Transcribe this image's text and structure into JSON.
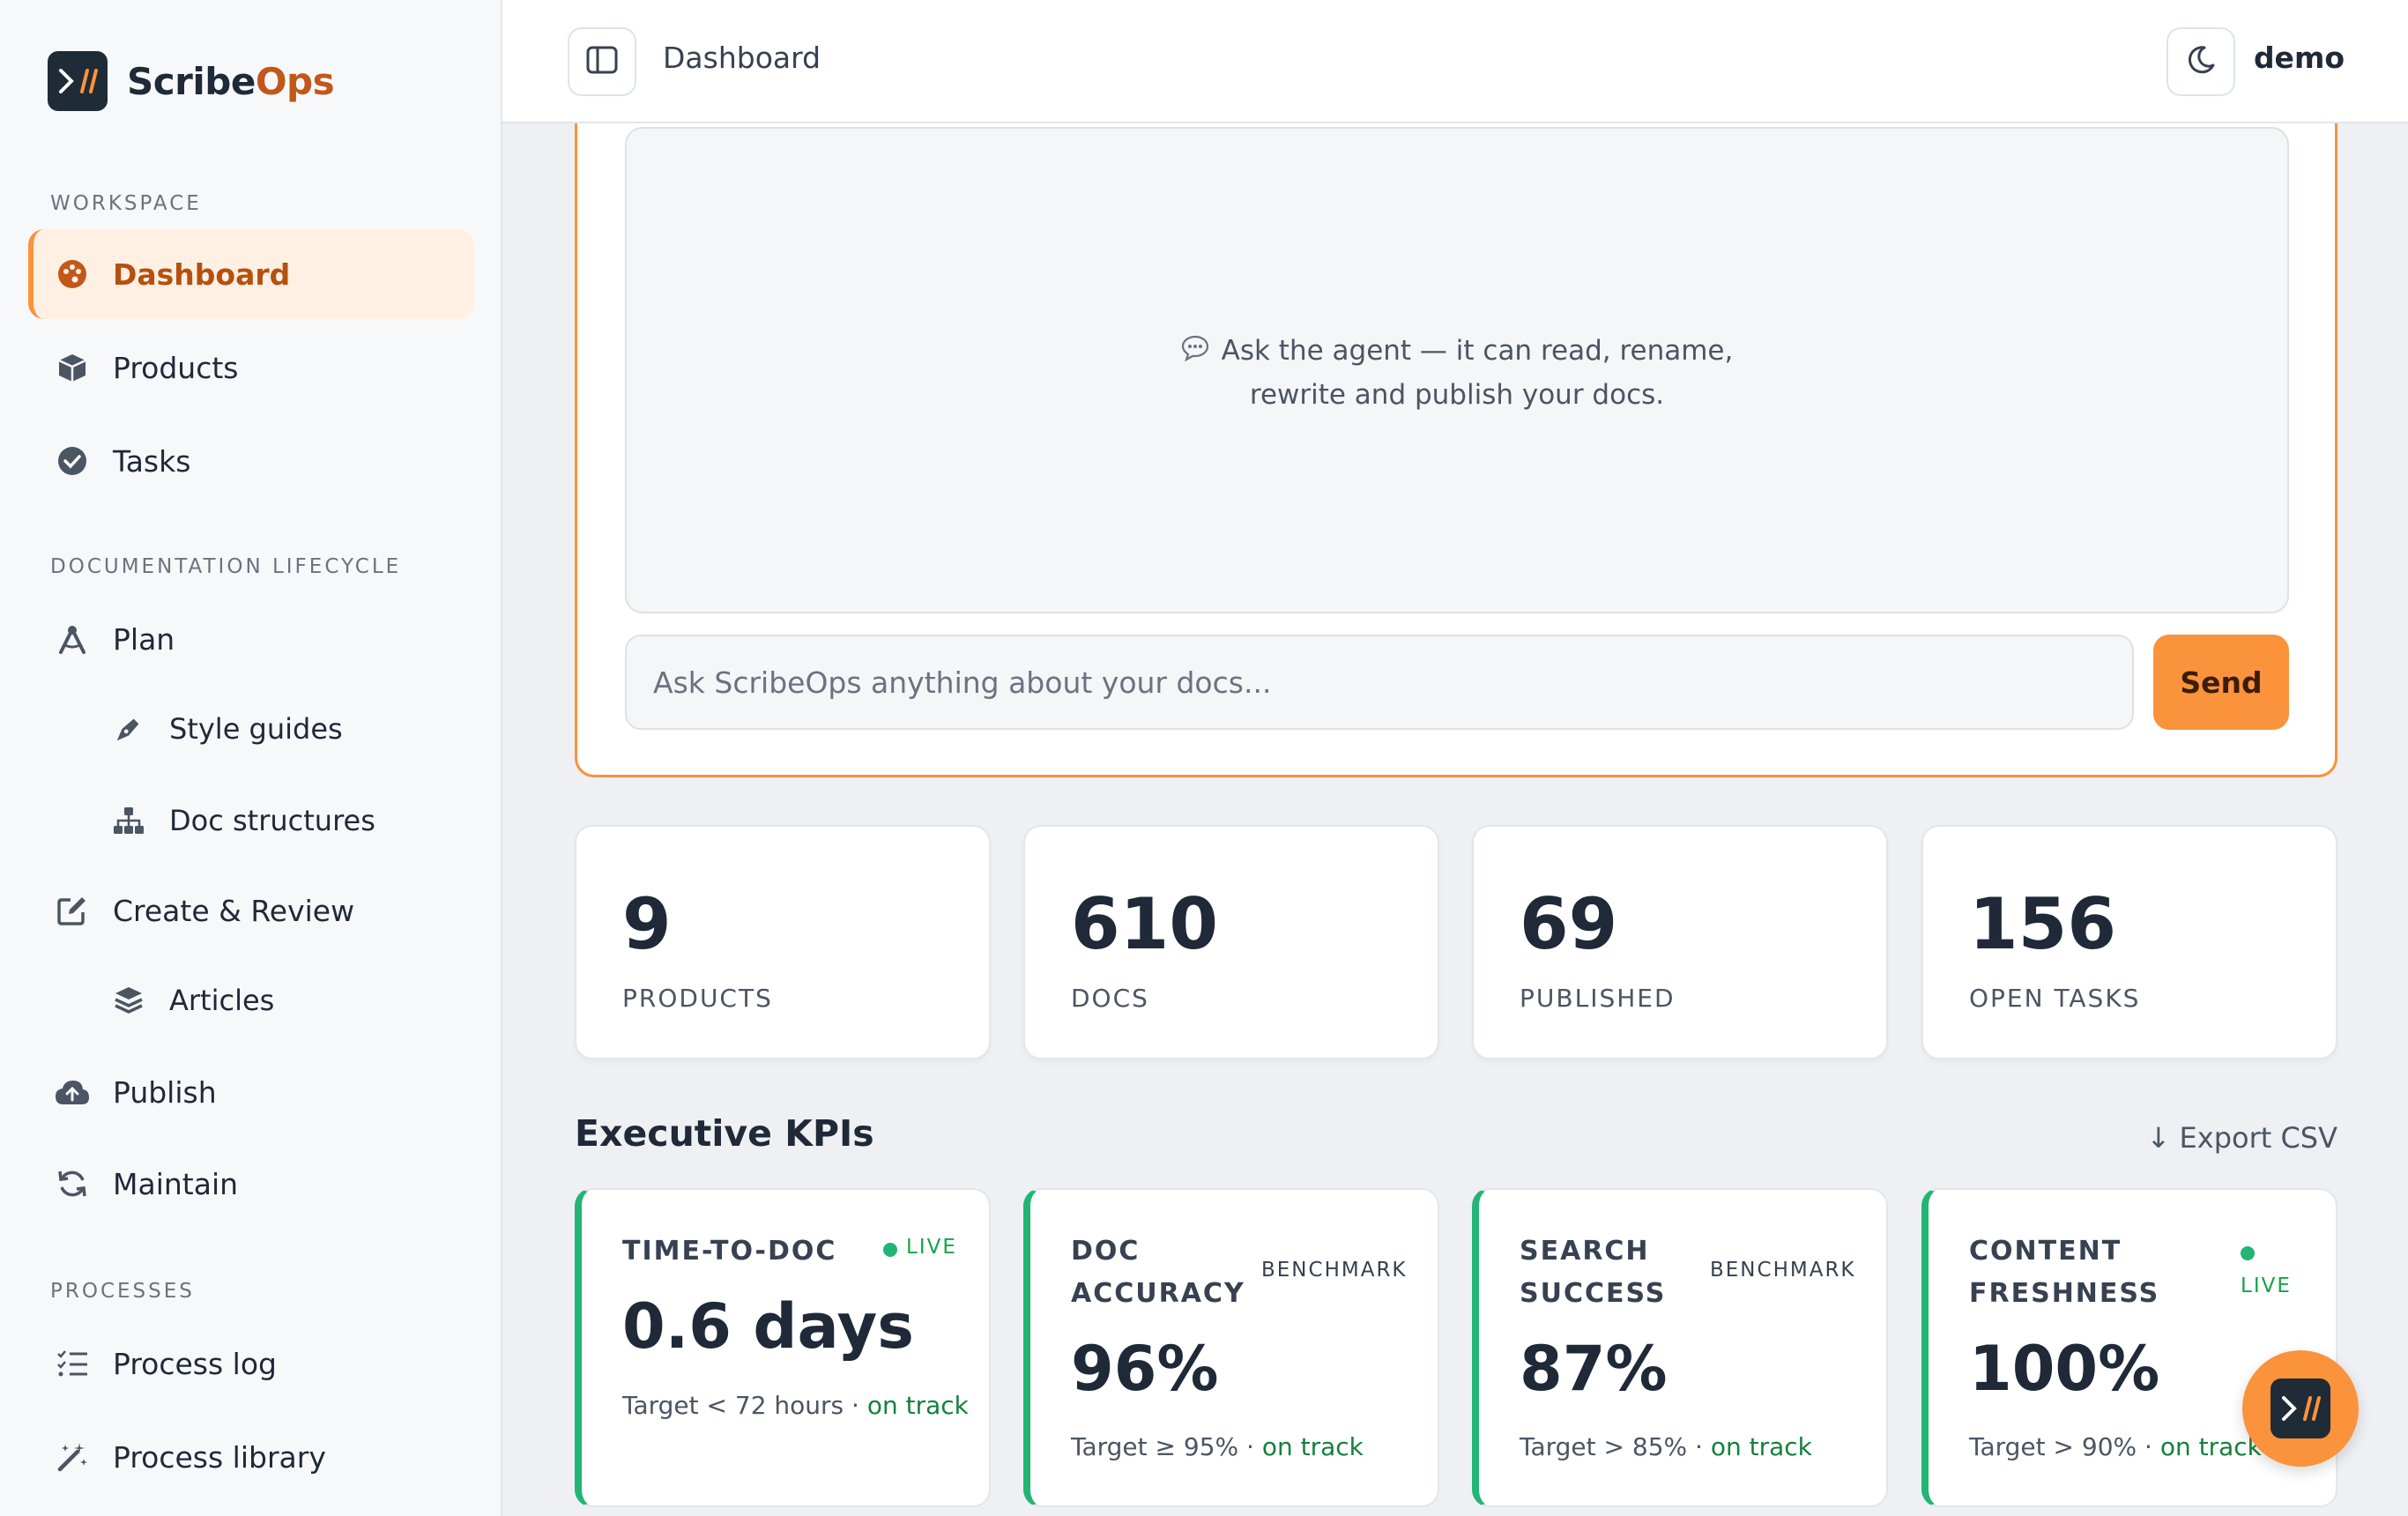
{
  "brand": {
    "name_part1": "Scribe",
    "name_part2": "Ops",
    "logo_glyph": ">//"
  },
  "sidebar": {
    "sections": [
      {
        "label": "WORKSPACE"
      },
      {
        "label": "DOCUMENTATION LIFECYCLE"
      },
      {
        "label": "PROCESSES"
      }
    ],
    "items": [
      {
        "label": "Dashboard",
        "icon": "palette-icon",
        "active": true
      },
      {
        "label": "Products",
        "icon": "box-icon"
      },
      {
        "label": "Tasks",
        "icon": "check-circle-icon"
      },
      {
        "label": "Plan",
        "icon": "compass-icon"
      },
      {
        "label": "Style guides",
        "icon": "pen-nib-icon"
      },
      {
        "label": "Doc structures",
        "icon": "sitemap-icon"
      },
      {
        "label": "Create & Review",
        "icon": "edit-icon"
      },
      {
        "label": "Articles",
        "icon": "layers-icon"
      },
      {
        "label": "Publish",
        "icon": "cloud-upload-icon"
      },
      {
        "label": "Maintain",
        "icon": "sync-icon"
      },
      {
        "label": "Process log",
        "icon": "list-check-icon"
      },
      {
        "label": "Process library",
        "icon": "magic-wand-icon"
      }
    ]
  },
  "topbar": {
    "breadcrumb": "Dashboard",
    "user": "demo"
  },
  "chat": {
    "hint_line1": "Ask the agent — it can read, rename,",
    "hint_line2": "rewrite and publish your docs.",
    "input_placeholder": "Ask ScribeOps anything about your docs...",
    "send_label": "Send"
  },
  "stats": [
    {
      "value": "9",
      "label": "PRODUCTS"
    },
    {
      "value": "610",
      "label": "DOCS"
    },
    {
      "value": "69",
      "label": "PUBLISHED"
    },
    {
      "value": "156",
      "label": "OPEN TASKS"
    }
  ],
  "kpis": {
    "title": "Executive KPIs",
    "export_label": "↓ Export CSV",
    "cards": [
      {
        "name_line1": "TIME-TO-DOC",
        "name_line2": "",
        "tag": "LIVE",
        "value": "0.6 days",
        "target": "Target < 72 hours · ",
        "status": "on track"
      },
      {
        "name_line1": "DOC",
        "name_line2": "ACCURACY",
        "tag": "BENCHMARK",
        "value": "96%",
        "target": "Target ≥ 95% · ",
        "status": "on track"
      },
      {
        "name_line1": "SEARCH",
        "name_line2": "SUCCESS",
        "tag": "BENCHMARK",
        "value": "87%",
        "target": "Target > 85% · ",
        "status": "on track"
      },
      {
        "name_line1": "CONTENT",
        "name_line2": "FRESHNESS",
        "tag": "LIVE",
        "value": "100%",
        "target": "Target > 90% · ",
        "status": "on track"
      }
    ]
  },
  "colors": {
    "accent": "#fb923c",
    "brand_dark": "#1f2b36",
    "success": "#22b573",
    "active_text": "#b5500f"
  }
}
